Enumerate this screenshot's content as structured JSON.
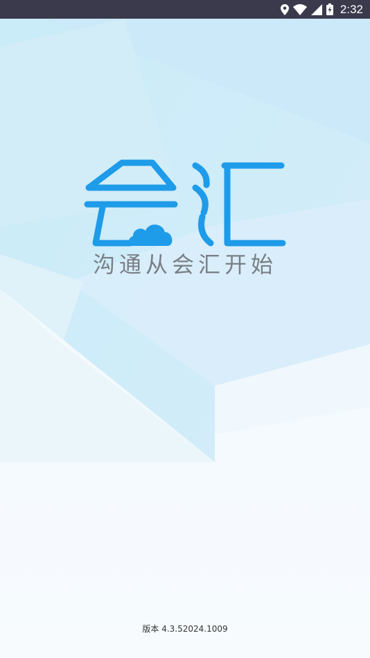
{
  "status_bar": {
    "time": "2:32",
    "icons": [
      "location-icon",
      "wifi-icon",
      "cell-signal-icon",
      "battery-charging-icon"
    ]
  },
  "splash": {
    "logo_text": "会汇",
    "slogan": "沟通从会汇开始",
    "version": "版本 4.3.52024.1009"
  },
  "colors": {
    "status_bar_bg": "#3b3a4d",
    "brand_blue": "#1e9be9",
    "slogan_gray": "#7a7f86",
    "background_light": "#e9f5fc"
  }
}
